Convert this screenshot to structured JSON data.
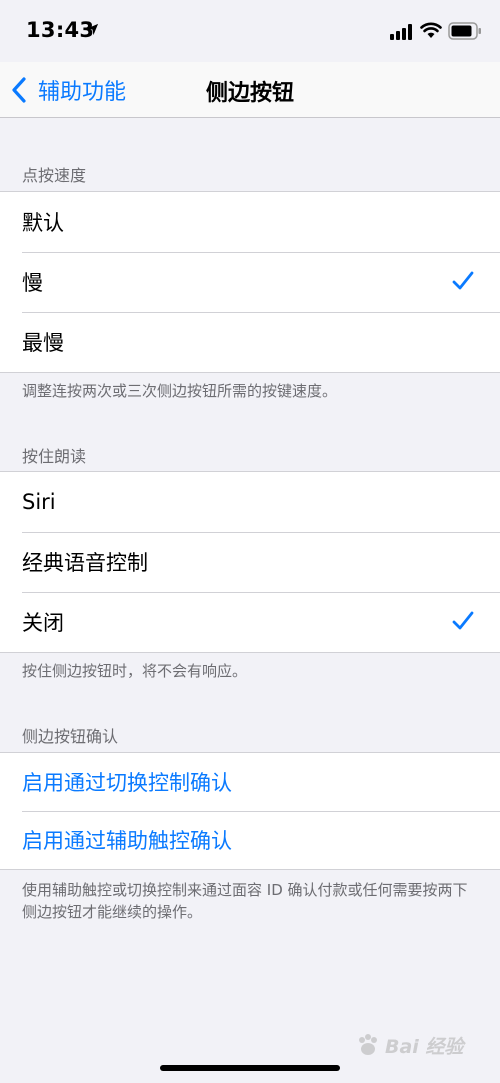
{
  "status_bar": {
    "time": "13:43",
    "icons": [
      "location-arrow-icon",
      "cellular-signal-icon",
      "wifi-icon",
      "battery-icon"
    ]
  },
  "nav": {
    "back_label": "辅助功能",
    "title": "侧边按钮"
  },
  "sections": [
    {
      "header": "点按速度",
      "rows": [
        {
          "label": "默认",
          "checked": false
        },
        {
          "label": "慢",
          "checked": true
        },
        {
          "label": "最慢",
          "checked": false
        }
      ],
      "footer": "调整连按两次或三次侧边按钮所需的按键速度。"
    },
    {
      "header": "按住朗读",
      "rows": [
        {
          "label": "Siri",
          "checked": false
        },
        {
          "label": "经典语音控制",
          "checked": false
        },
        {
          "label": "关闭",
          "checked": true
        }
      ],
      "footer": "按住侧边按钮时，将不会有响应。"
    },
    {
      "header": "侧边按钮确认",
      "rows": [
        {
          "label": "启用通过切换控制确认"
        },
        {
          "label": "启用通过辅助触控确认"
        }
      ],
      "footer": "使用辅助触控或切换控制来通过面容 ID 确认付款或任何需要按两下侧边按钮才能继续的操作。"
    }
  ],
  "colors": {
    "accent": "#0a7aff",
    "background": "#f2f2f7",
    "secondary_text": "#6d6d72"
  },
  "watermark": {
    "text": "Bai 经验"
  }
}
